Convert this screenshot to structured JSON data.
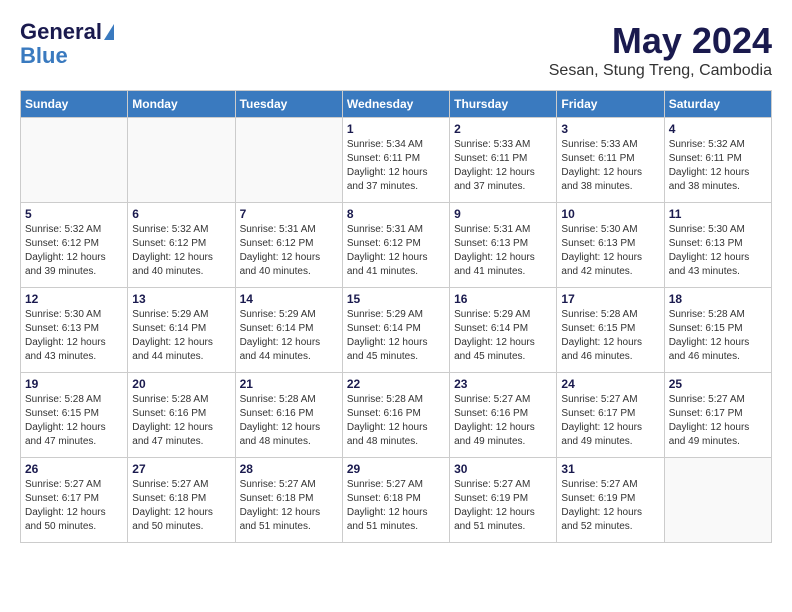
{
  "header": {
    "logo_line1": "General",
    "logo_line2": "Blue",
    "month": "May 2024",
    "location": "Sesan, Stung Treng, Cambodia"
  },
  "days_of_week": [
    "Sunday",
    "Monday",
    "Tuesday",
    "Wednesday",
    "Thursday",
    "Friday",
    "Saturday"
  ],
  "weeks": [
    [
      {
        "day": "",
        "info": ""
      },
      {
        "day": "",
        "info": ""
      },
      {
        "day": "",
        "info": ""
      },
      {
        "day": "1",
        "info": "Sunrise: 5:34 AM\nSunset: 6:11 PM\nDaylight: 12 hours\nand 37 minutes."
      },
      {
        "day": "2",
        "info": "Sunrise: 5:33 AM\nSunset: 6:11 PM\nDaylight: 12 hours\nand 37 minutes."
      },
      {
        "day": "3",
        "info": "Sunrise: 5:33 AM\nSunset: 6:11 PM\nDaylight: 12 hours\nand 38 minutes."
      },
      {
        "day": "4",
        "info": "Sunrise: 5:32 AM\nSunset: 6:11 PM\nDaylight: 12 hours\nand 38 minutes."
      }
    ],
    [
      {
        "day": "5",
        "info": "Sunrise: 5:32 AM\nSunset: 6:12 PM\nDaylight: 12 hours\nand 39 minutes."
      },
      {
        "day": "6",
        "info": "Sunrise: 5:32 AM\nSunset: 6:12 PM\nDaylight: 12 hours\nand 40 minutes."
      },
      {
        "day": "7",
        "info": "Sunrise: 5:31 AM\nSunset: 6:12 PM\nDaylight: 12 hours\nand 40 minutes."
      },
      {
        "day": "8",
        "info": "Sunrise: 5:31 AM\nSunset: 6:12 PM\nDaylight: 12 hours\nand 41 minutes."
      },
      {
        "day": "9",
        "info": "Sunrise: 5:31 AM\nSunset: 6:13 PM\nDaylight: 12 hours\nand 41 minutes."
      },
      {
        "day": "10",
        "info": "Sunrise: 5:30 AM\nSunset: 6:13 PM\nDaylight: 12 hours\nand 42 minutes."
      },
      {
        "day": "11",
        "info": "Sunrise: 5:30 AM\nSunset: 6:13 PM\nDaylight: 12 hours\nand 43 minutes."
      }
    ],
    [
      {
        "day": "12",
        "info": "Sunrise: 5:30 AM\nSunset: 6:13 PM\nDaylight: 12 hours\nand 43 minutes."
      },
      {
        "day": "13",
        "info": "Sunrise: 5:29 AM\nSunset: 6:14 PM\nDaylight: 12 hours\nand 44 minutes."
      },
      {
        "day": "14",
        "info": "Sunrise: 5:29 AM\nSunset: 6:14 PM\nDaylight: 12 hours\nand 44 minutes."
      },
      {
        "day": "15",
        "info": "Sunrise: 5:29 AM\nSunset: 6:14 PM\nDaylight: 12 hours\nand 45 minutes."
      },
      {
        "day": "16",
        "info": "Sunrise: 5:29 AM\nSunset: 6:14 PM\nDaylight: 12 hours\nand 45 minutes."
      },
      {
        "day": "17",
        "info": "Sunrise: 5:28 AM\nSunset: 6:15 PM\nDaylight: 12 hours\nand 46 minutes."
      },
      {
        "day": "18",
        "info": "Sunrise: 5:28 AM\nSunset: 6:15 PM\nDaylight: 12 hours\nand 46 minutes."
      }
    ],
    [
      {
        "day": "19",
        "info": "Sunrise: 5:28 AM\nSunset: 6:15 PM\nDaylight: 12 hours\nand 47 minutes."
      },
      {
        "day": "20",
        "info": "Sunrise: 5:28 AM\nSunset: 6:16 PM\nDaylight: 12 hours\nand 47 minutes."
      },
      {
        "day": "21",
        "info": "Sunrise: 5:28 AM\nSunset: 6:16 PM\nDaylight: 12 hours\nand 48 minutes."
      },
      {
        "day": "22",
        "info": "Sunrise: 5:28 AM\nSunset: 6:16 PM\nDaylight: 12 hours\nand 48 minutes."
      },
      {
        "day": "23",
        "info": "Sunrise: 5:27 AM\nSunset: 6:16 PM\nDaylight: 12 hours\nand 49 minutes."
      },
      {
        "day": "24",
        "info": "Sunrise: 5:27 AM\nSunset: 6:17 PM\nDaylight: 12 hours\nand 49 minutes."
      },
      {
        "day": "25",
        "info": "Sunrise: 5:27 AM\nSunset: 6:17 PM\nDaylight: 12 hours\nand 49 minutes."
      }
    ],
    [
      {
        "day": "26",
        "info": "Sunrise: 5:27 AM\nSunset: 6:17 PM\nDaylight: 12 hours\nand 50 minutes."
      },
      {
        "day": "27",
        "info": "Sunrise: 5:27 AM\nSunset: 6:18 PM\nDaylight: 12 hours\nand 50 minutes."
      },
      {
        "day": "28",
        "info": "Sunrise: 5:27 AM\nSunset: 6:18 PM\nDaylight: 12 hours\nand 51 minutes."
      },
      {
        "day": "29",
        "info": "Sunrise: 5:27 AM\nSunset: 6:18 PM\nDaylight: 12 hours\nand 51 minutes."
      },
      {
        "day": "30",
        "info": "Sunrise: 5:27 AM\nSunset: 6:19 PM\nDaylight: 12 hours\nand 51 minutes."
      },
      {
        "day": "31",
        "info": "Sunrise: 5:27 AM\nSunset: 6:19 PM\nDaylight: 12 hours\nand 52 minutes."
      },
      {
        "day": "",
        "info": ""
      }
    ]
  ]
}
